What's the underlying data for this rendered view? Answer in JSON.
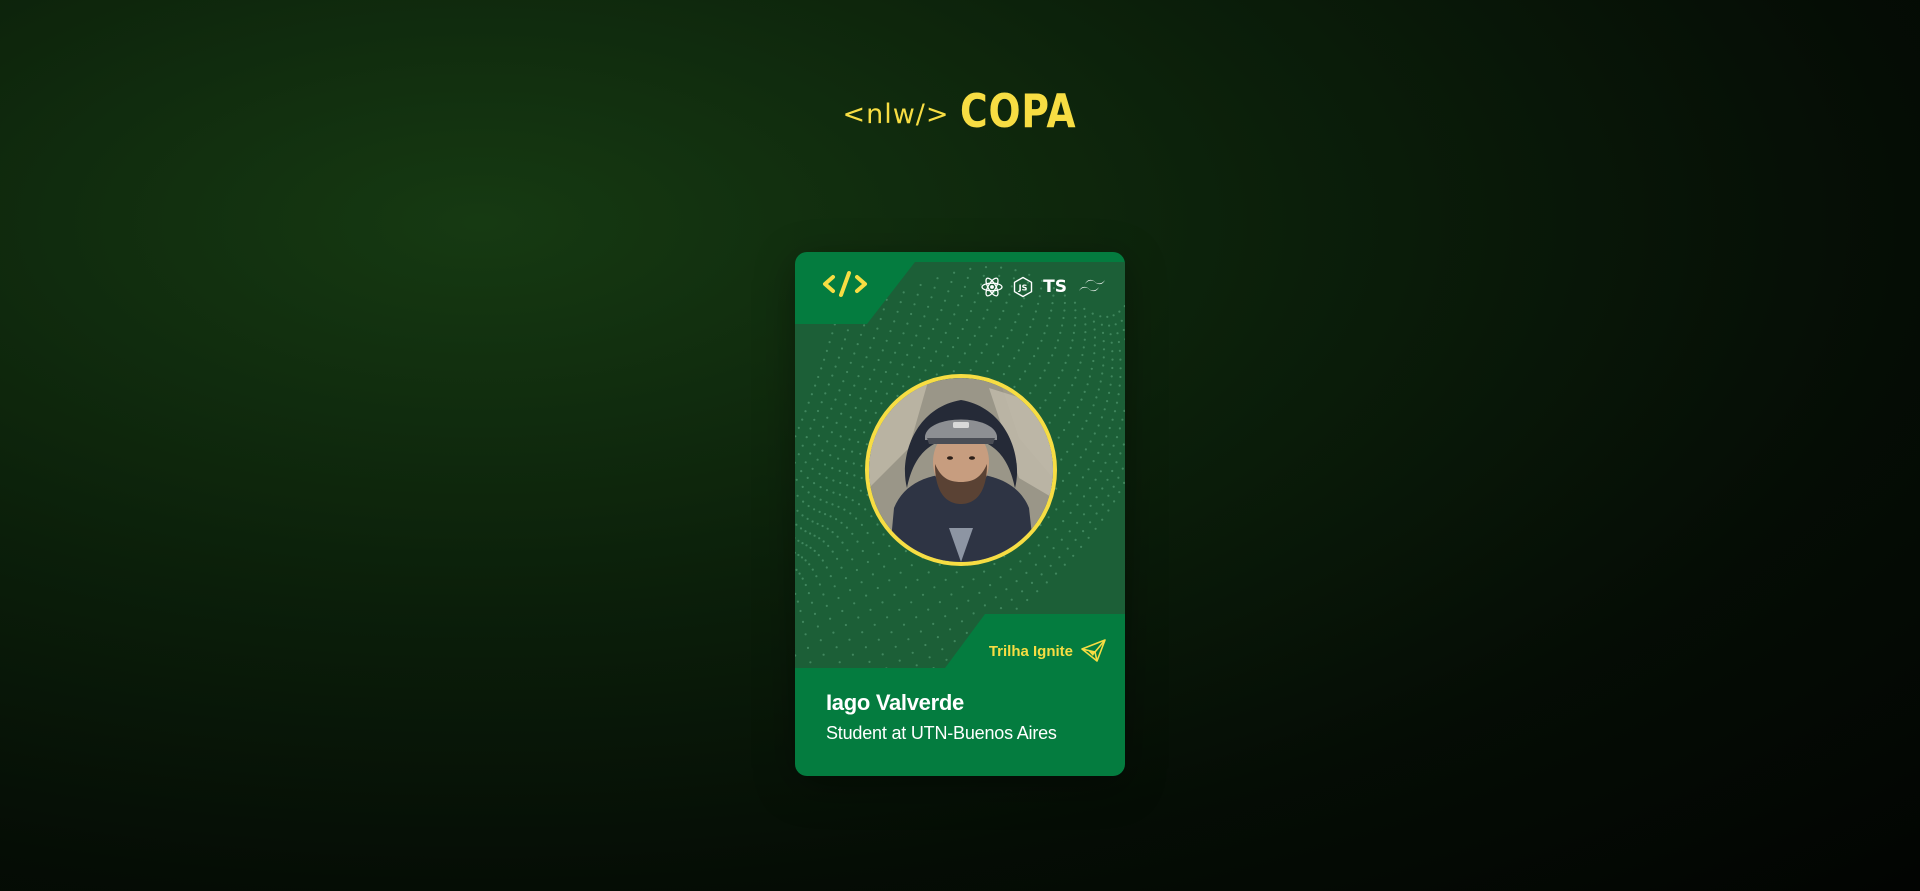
{
  "header": {
    "logo_code": "<nlw/>",
    "logo_title": "COPA"
  },
  "card": {
    "code_icon": "code-brackets-icon",
    "tech_icons": [
      "react-icon",
      "nodejs-icon",
      "typescript-icon",
      "tailwind-icon"
    ],
    "ts_label": "TS",
    "avatar": "user-photo-avatar",
    "track_label": "Trilha Ignite",
    "track_icon": "paper-plane-icon",
    "name": "Iago Valverde",
    "role": "Student at UTN-Buenos Aires"
  },
  "colors": {
    "accent_yellow": "#f7dd43",
    "card_green": "#047c3f",
    "card_panel": "#1c5f37",
    "text_white": "#ffffff"
  }
}
